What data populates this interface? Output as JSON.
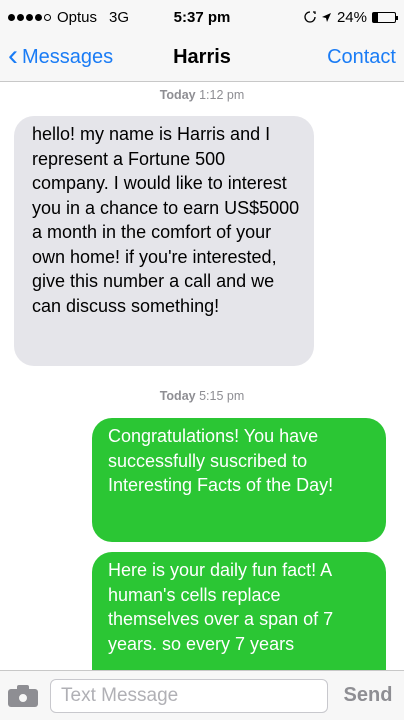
{
  "status_bar": {
    "carrier": "Optus",
    "network": "3G",
    "time": "5:37 pm",
    "battery_text": "24%",
    "battery_level": 0.24,
    "signal_bars_filled": 4,
    "signal_bars_total": 5,
    "icons": [
      "signal-dots-icon",
      "rotation-lock-icon",
      "location-arrow-icon",
      "battery-icon"
    ]
  },
  "nav": {
    "back_label": "Messages",
    "title": "Harris",
    "contact_label": "Contact"
  },
  "conversation": {
    "timestamp_1": {
      "day": "Today",
      "time": "1:12 pm"
    },
    "incoming_message": "hello! my name is Harris and I represent a Fortune 500 company. I would like to interest you in a chance to earn US$5000 a month in the comfort of your own home! if you're interested, give this number a call and we can discuss something!",
    "timestamp_2": {
      "day": "Today",
      "time": "5:15 pm"
    },
    "outgoing_message_1": "Congratulations! You have successfully suscribed to Interesting Facts of the Day!",
    "outgoing_message_2": "Here is your daily fun fact! A human's cells replace themselves over a span of 7 years. so every 7 years"
  },
  "input_bar": {
    "placeholder": "Text Message",
    "send_label": "Send",
    "camera_icon": "camera-icon"
  },
  "colors": {
    "ios_blue": "#1a7cf5",
    "incoming_bubble": "#e5e5ea",
    "outgoing_bubble": "#2bc634",
    "timestamp_gray": "#8e8e93"
  }
}
